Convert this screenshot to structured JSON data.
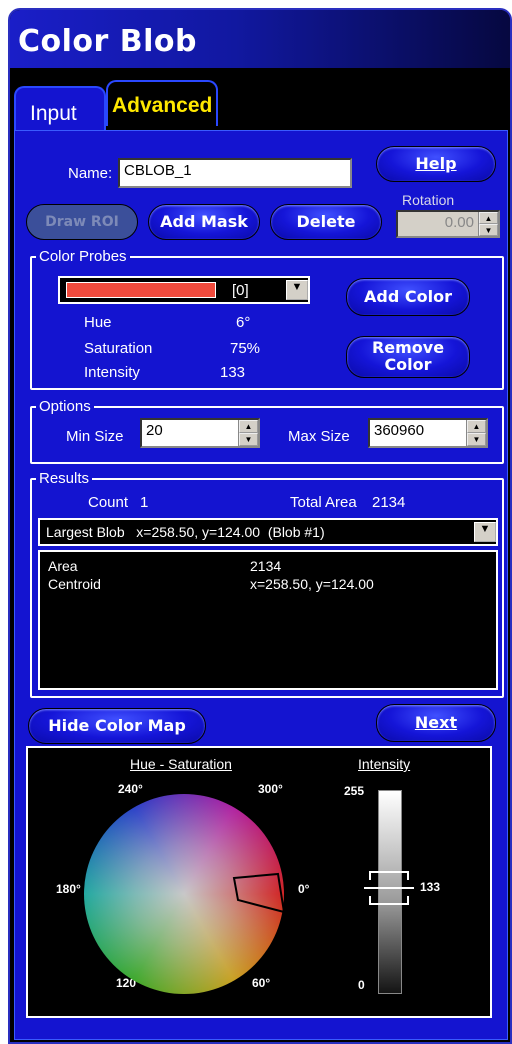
{
  "window": {
    "title": "Color Blob"
  },
  "tabs": [
    {
      "label": "Input",
      "active": true
    },
    {
      "label": "Advanced",
      "active": false
    }
  ],
  "name_field": {
    "label": "Name:",
    "value": "CBLOB_1"
  },
  "buttons": {
    "help": "Help",
    "draw_roi": "Draw ROI",
    "add_mask": "Add Mask",
    "delete": "Delete",
    "add_color": "Add Color",
    "remove_color": "Remove Color",
    "hide_color_map": "Hide Color Map",
    "next": "Next"
  },
  "rotation": {
    "label": "Rotation",
    "value": "0.00"
  },
  "color_probes": {
    "title": "Color Probes",
    "selected_index": "[0]",
    "swatch_color": "#f04a3c",
    "hue_label": "Hue",
    "hue_value": "6°",
    "saturation_label": "Saturation",
    "saturation_value": "75%",
    "intensity_label": "Intensity",
    "intensity_value": "133"
  },
  "options": {
    "title": "Options",
    "min_size_label": "Min Size",
    "min_size_value": "20",
    "max_size_label": "Max Size",
    "max_size_value": "360960"
  },
  "results": {
    "title": "Results",
    "count_label": "Count",
    "count_value": "1",
    "total_area_label": "Total Area",
    "total_area_value": "2134",
    "blob_select": "Largest Blob   x=258.50, y=124.00  (Blob #1)",
    "rows": [
      {
        "name": "Area",
        "value": "2134"
      },
      {
        "name": "Centroid",
        "value": "x=258.50, y=124.00"
      }
    ]
  },
  "color_map": {
    "hue_saturation_title": "Hue - Saturation",
    "intensity_title": "Intensity",
    "angle_labels": {
      "a240": "240°",
      "a300": "300°",
      "a180": "180°",
      "a0": "0°",
      "a120": "120°",
      "a60": "60°"
    },
    "intensity_max": "255",
    "intensity_min": "0",
    "intensity_marker": "133",
    "intensity_level": 133
  },
  "colors": {
    "title_bar": "#1414d0",
    "panel": "#1414d0",
    "accent_text": "#ffe800"
  }
}
